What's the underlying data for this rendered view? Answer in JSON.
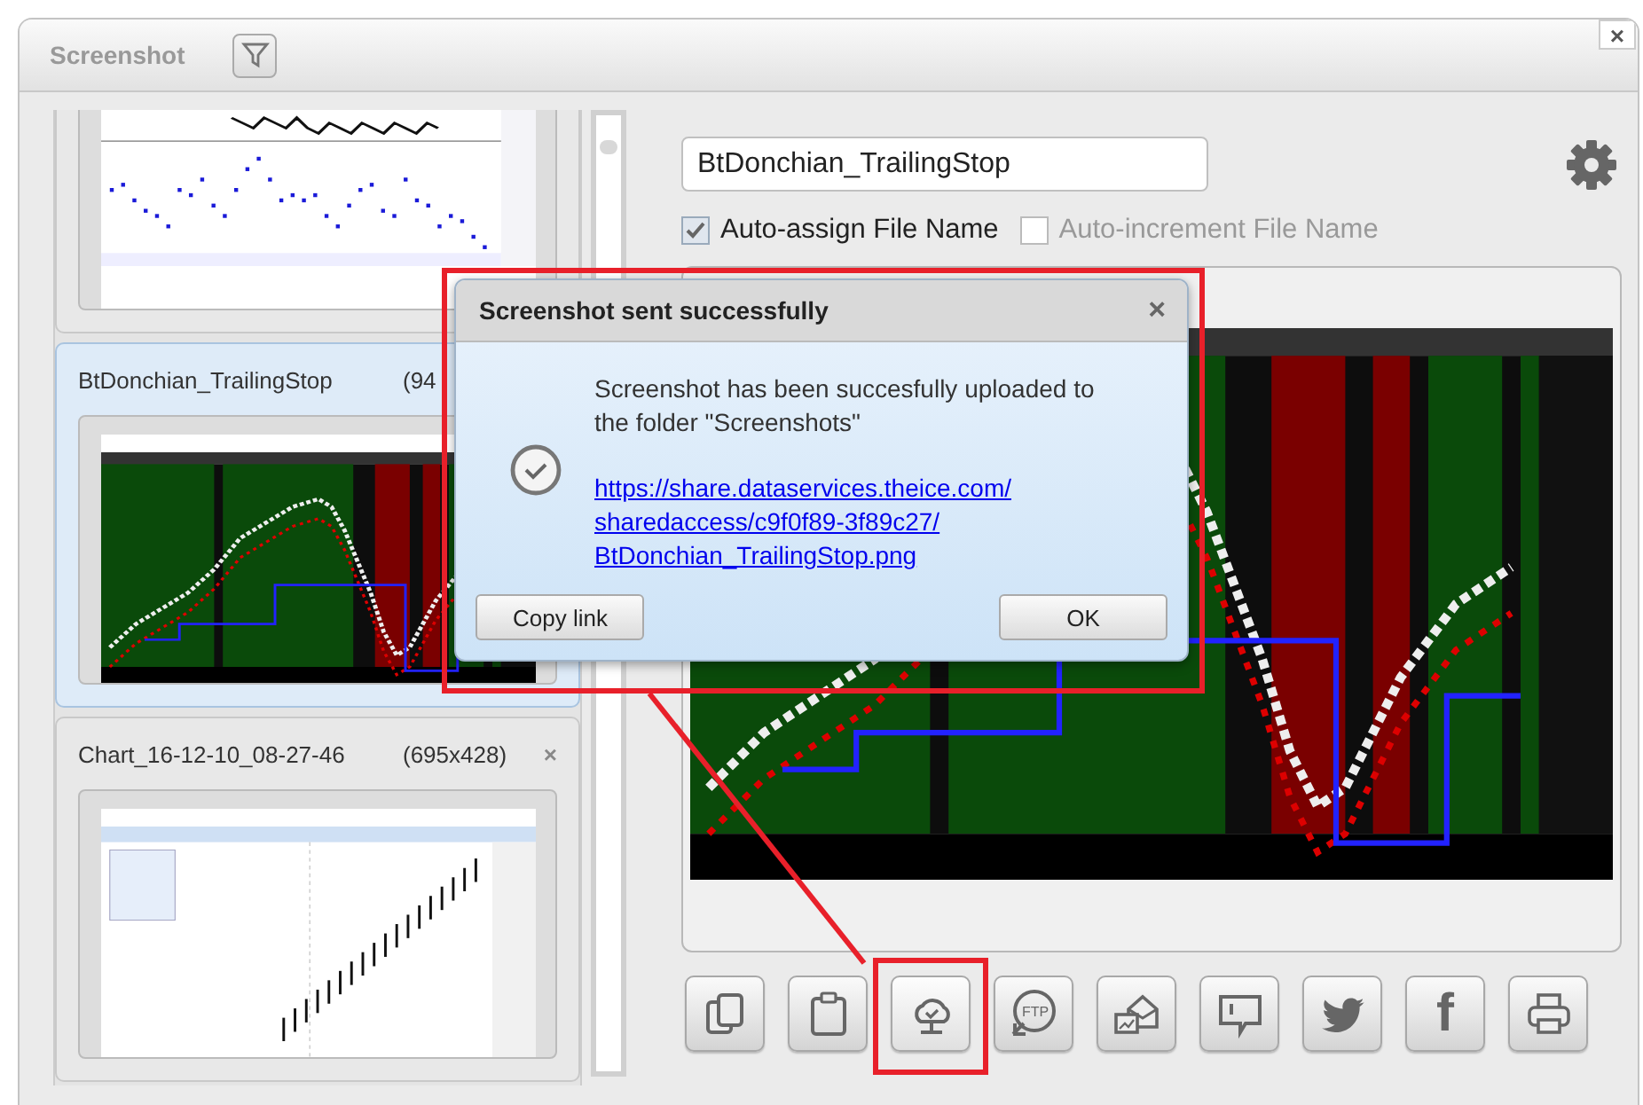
{
  "window": {
    "title": "Screenshot",
    "close": "×"
  },
  "sidebar": {
    "cards": [
      {
        "kind": "dots",
        "selected": false
      },
      {
        "kind": "bands",
        "title": "BtDonchian_TrailingStop",
        "size": "(94",
        "selected": true
      },
      {
        "kind": "bars",
        "title": "Chart_16-12-10_08-27-46",
        "size": "(695x428)",
        "close": "×",
        "selected": false
      }
    ]
  },
  "file_name": {
    "value": "BtDonchian_TrailingStop"
  },
  "options": [
    {
      "label": "Auto-assign File Name",
      "checked": true,
      "disabled": false
    },
    {
      "label": "Auto-increment File Name",
      "checked": false,
      "disabled": true
    }
  ],
  "toolbar": [
    {
      "kind": "copy",
      "highlighted": false
    },
    {
      "kind": "paste",
      "highlighted": false
    },
    {
      "kind": "cloud",
      "highlighted": true
    },
    {
      "kind": "ftp",
      "glyph": "FTP",
      "highlighted": false
    },
    {
      "kind": "mail",
      "highlighted": false
    },
    {
      "kind": "comment",
      "highlighted": false
    },
    {
      "kind": "bird",
      "highlighted": false
    },
    {
      "kind": "letter",
      "glyph": "f",
      "highlighted": false
    },
    {
      "kind": "print",
      "highlighted": false
    }
  ],
  "dialog": {
    "title": "Screenshot sent successfully",
    "close": "×",
    "message": "Screenshot has been succesfully uploaded to the folder \"Screenshots\"",
    "link_lines": [
      "https://share.dataservices.theice.com/",
      "sharedaccess/c9f0f89-3f89c27/",
      "BtDonchian_TrailingStop.png"
    ],
    "buttons": [
      "Copy link",
      "OK"
    ]
  }
}
